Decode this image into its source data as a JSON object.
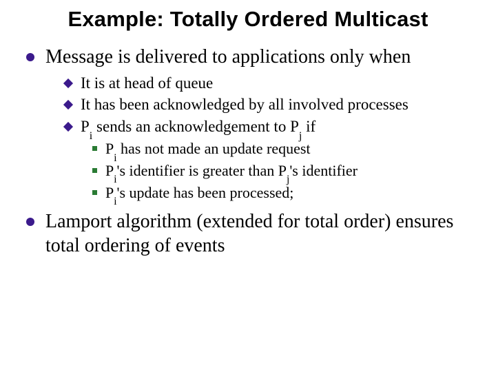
{
  "title": "Example: Totally Ordered Multicast",
  "bullets": {
    "b1": "Message is delivered to applications only when",
    "b1a": "It is at head of queue",
    "b1b": "It has been acknowledged by all involved processes",
    "b1c_pre": "P",
    "b1c_mid": " sends an acknowledgement to P",
    "b1c_post": " if",
    "b1c1_pre": "P",
    "b1c1_post": " has not made an update request",
    "b1c2_pre": "P",
    "b1c2_mid1": "'s identifier is greater than P",
    "b1c2_mid2": "'s identifier",
    "b1c3_pre": "P",
    "b1c3_post": "'s update has been processed;",
    "b2": "Lamport algorithm (extended for total order) ensures total ordering of events"
  },
  "sub": {
    "i": "i",
    "j": "j"
  }
}
